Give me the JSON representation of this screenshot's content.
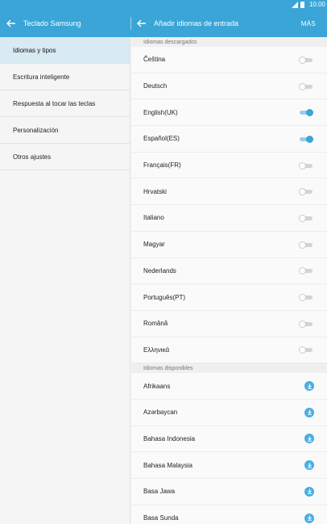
{
  "status": {
    "time": "10:00"
  },
  "header": {
    "left_title": "Teclado Samsung",
    "right_title": "Añadir idiomas de entrada",
    "more": "MÁS"
  },
  "left_menu": [
    {
      "label": "Idiomas y tipos",
      "active": true
    },
    {
      "label": "Escritura inteligente",
      "active": false
    },
    {
      "label": "Respuesta al tocar las teclas",
      "active": false
    },
    {
      "label": "Personalización",
      "active": false
    },
    {
      "label": "Otros ajustes",
      "active": false
    }
  ],
  "sections": {
    "downloaded_title": "Idiomas descargados",
    "available_title": "Idiomas disponibles"
  },
  "downloaded": [
    {
      "label": "Čeština",
      "enabled": false
    },
    {
      "label": "Deutsch",
      "enabled": false
    },
    {
      "label": "English(UK)",
      "enabled": true
    },
    {
      "label": "Español(ES)",
      "enabled": true
    },
    {
      "label": "Français(FR)",
      "enabled": false
    },
    {
      "label": "Hrvatski",
      "enabled": false
    },
    {
      "label": "Italiano",
      "enabled": false
    },
    {
      "label": "Magyar",
      "enabled": false
    },
    {
      "label": "Nederlands",
      "enabled": false
    },
    {
      "label": "Português(PT)",
      "enabled": false
    },
    {
      "label": "Română",
      "enabled": false
    },
    {
      "label": "Ελληνικά",
      "enabled": false
    }
  ],
  "available": [
    {
      "label": "Afrikaans"
    },
    {
      "label": "Azərbaycan"
    },
    {
      "label": "Bahasa Indonesia"
    },
    {
      "label": "Bahasa Malaysia"
    },
    {
      "label": "Basa Jawa"
    },
    {
      "label": "Basa Sunda"
    }
  ],
  "colors": {
    "accent": "#3aa5d6",
    "active_bg": "#d8eaf2"
  }
}
